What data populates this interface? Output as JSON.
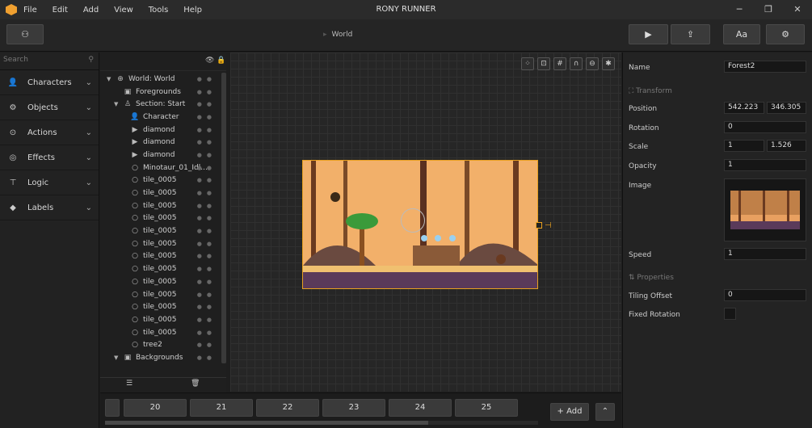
{
  "app": {
    "title": "RONY RUNNER",
    "menu": [
      "File",
      "Edit",
      "Add",
      "View",
      "Tools",
      "Help"
    ]
  },
  "toolbar": {
    "scene": "World",
    "font_btn": "Aa"
  },
  "sidebar": {
    "search_placeholder": "Search",
    "items": [
      {
        "label": "Characters",
        "icon": "person-icon"
      },
      {
        "label": "Objects",
        "icon": "gear-icon"
      },
      {
        "label": "Actions",
        "icon": "play-circle-icon"
      },
      {
        "label": "Effects",
        "icon": "swirl-icon"
      },
      {
        "label": "Logic",
        "icon": "logic-icon"
      },
      {
        "label": "Labels",
        "icon": "tag-icon"
      }
    ]
  },
  "tree": [
    {
      "label": "World: World",
      "depth": 0,
      "arrow": "▼",
      "icon": "globe-icon"
    },
    {
      "label": "Foregrounds",
      "depth": 1,
      "arrow": "",
      "icon": "image-icon"
    },
    {
      "label": "Section: Start",
      "depth": 1,
      "arrow": "▼",
      "icon": "section-icon"
    },
    {
      "label": "Character",
      "depth": 2,
      "arrow": "",
      "icon": "person-icon"
    },
    {
      "label": "diamond",
      "depth": 2,
      "arrow": "",
      "icon": "play-icon"
    },
    {
      "label": "diamond",
      "depth": 2,
      "arrow": "",
      "icon": "play-icon"
    },
    {
      "label": "diamond",
      "depth": 2,
      "arrow": "",
      "icon": "play-icon"
    },
    {
      "label": "Minotaur_01_Idl...",
      "depth": 2,
      "arrow": "",
      "icon": "object-icon"
    },
    {
      "label": "tile_0005",
      "depth": 2,
      "arrow": "",
      "icon": "object-icon"
    },
    {
      "label": "tile_0005",
      "depth": 2,
      "arrow": "",
      "icon": "object-icon"
    },
    {
      "label": "tile_0005",
      "depth": 2,
      "arrow": "",
      "icon": "object-icon"
    },
    {
      "label": "tile_0005",
      "depth": 2,
      "arrow": "",
      "icon": "object-icon"
    },
    {
      "label": "tile_0005",
      "depth": 2,
      "arrow": "",
      "icon": "object-icon"
    },
    {
      "label": "tile_0005",
      "depth": 2,
      "arrow": "",
      "icon": "object-icon"
    },
    {
      "label": "tile_0005",
      "depth": 2,
      "arrow": "",
      "icon": "object-icon"
    },
    {
      "label": "tile_0005",
      "depth": 2,
      "arrow": "",
      "icon": "object-icon"
    },
    {
      "label": "tile_0005",
      "depth": 2,
      "arrow": "",
      "icon": "object-icon"
    },
    {
      "label": "tile_0005",
      "depth": 2,
      "arrow": "",
      "icon": "object-icon"
    },
    {
      "label": "tile_0005",
      "depth": 2,
      "arrow": "",
      "icon": "object-icon"
    },
    {
      "label": "tile_0005",
      "depth": 2,
      "arrow": "",
      "icon": "object-icon"
    },
    {
      "label": "tile_0005",
      "depth": 2,
      "arrow": "",
      "icon": "object-icon"
    },
    {
      "label": "tree2",
      "depth": 2,
      "arrow": "",
      "icon": "object-icon"
    },
    {
      "label": "Backgrounds",
      "depth": 1,
      "arrow": "▼",
      "icon": "image-icon"
    }
  ],
  "timeline": {
    "frames": [
      "20",
      "21",
      "22",
      "23",
      "24",
      "25"
    ],
    "add_label": "+ Add"
  },
  "props": {
    "name_label": "Name",
    "name_value": "Forest2",
    "transform_label": "Transform",
    "position_label": "Position",
    "pos_x": "542.223",
    "pos_y": "346.305",
    "rotation_label": "Rotation",
    "rotation": "0",
    "scale_label": "Scale",
    "scale_x": "1",
    "scale_y": "1.526",
    "opacity_label": "Opacity",
    "opacity": "1",
    "image_label": "Image",
    "speed_label": "Speed",
    "speed": "1",
    "properties_label": "Properties",
    "tiling_label": "Tiling Offset",
    "tiling": "0",
    "fixed_label": "Fixed Rotation"
  },
  "colors": {
    "accent": "#e8a020",
    "selection": "#e8a020"
  }
}
